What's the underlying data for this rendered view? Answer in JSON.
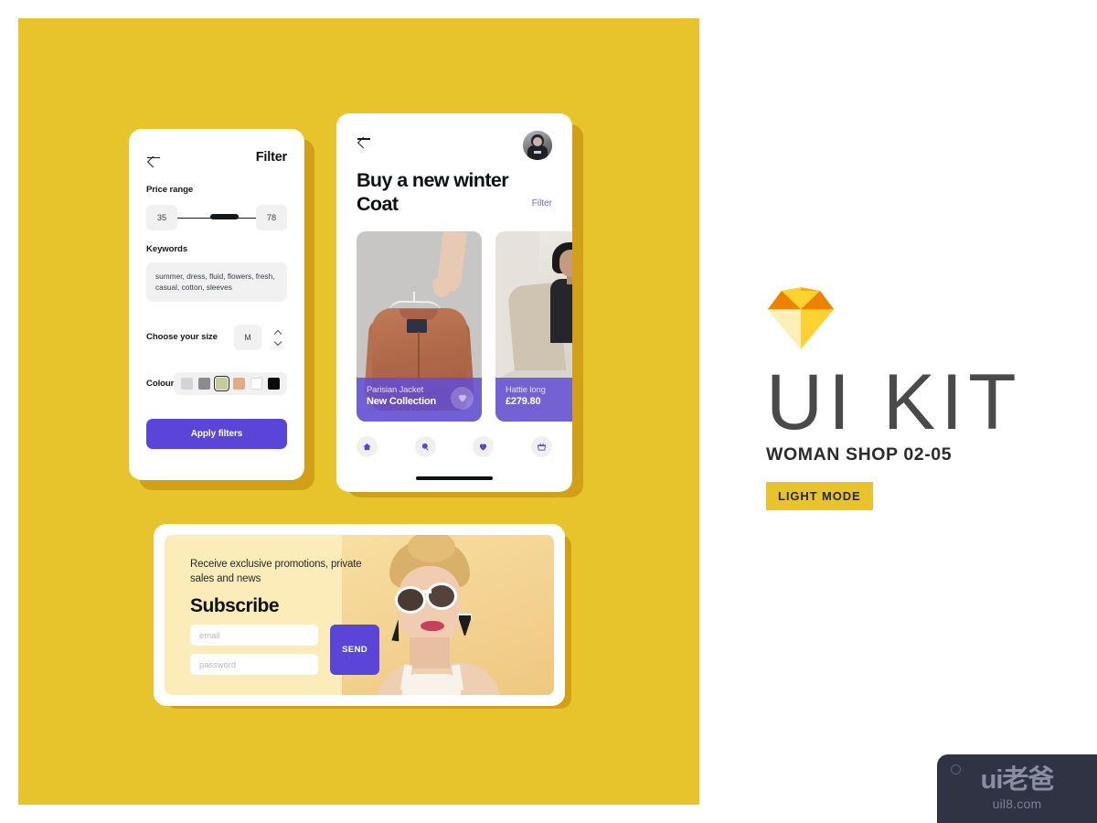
{
  "theme": {
    "backdrop_yellow": "#e8c42c",
    "card_shadow_gold": "#d2a017",
    "accent_purple": "#5a45d8",
    "link_purple": "#6e63d2",
    "text_dark": "#0f1013"
  },
  "filter_screen": {
    "back_icon": "back-arrow-icon",
    "title": "Filter",
    "price": {
      "label": "Price range",
      "min_value": "35",
      "max_value": "78"
    },
    "keywords": {
      "label": "Keywords",
      "value": "summer, dress, fluid, flowers, fresh, casual, cotton, sleeves"
    },
    "size": {
      "label": "Choose your size",
      "value": "M",
      "increase_icon": "chevron-up-icon",
      "decrease_icon": "chevron-down-icon"
    },
    "colour": {
      "label": "Colour",
      "swatches": [
        {
          "name": "light-grey",
          "hex": "#d4d4d6",
          "selected": false
        },
        {
          "name": "grey",
          "hex": "#8b8b8d",
          "selected": false
        },
        {
          "name": "khaki",
          "hex": "#c7cb9c",
          "selected": true
        },
        {
          "name": "salmon",
          "hex": "#e3ab8a",
          "selected": false
        },
        {
          "name": "white",
          "hex": "#ffffff",
          "selected": false
        },
        {
          "name": "black",
          "hex": "#0b0b0d",
          "selected": false
        }
      ]
    },
    "apply_label": "Apply filters"
  },
  "shop_screen": {
    "back_icon": "back-arrow-icon",
    "avatar": "user-avatar",
    "title": "Buy a new winter Coat",
    "filter_link": "Filter",
    "products": [
      {
        "name": "Parisian Jacket",
        "subtitle": "New Collection",
        "image": "brown-jacket-on-hanger",
        "favourite_icon": "heart-icon"
      },
      {
        "name": "Hattie long",
        "subtitle": "£279.80",
        "image": "woman-in-beige-coat"
      }
    ],
    "tabs": [
      {
        "name": "home-icon"
      },
      {
        "name": "search-icon"
      },
      {
        "name": "heart-icon"
      },
      {
        "name": "basket-icon"
      }
    ]
  },
  "subscribe_card": {
    "kicker": "Receive exclusive promotions, private sales and news",
    "title": "Subscribe",
    "email_placeholder": "email",
    "email_value": "",
    "password_placeholder": "password",
    "password_value": "",
    "send_label": "SEND",
    "photo": "woman-with-white-sunglasses"
  },
  "branding": {
    "logo": "sketch-diamond-logo",
    "ui_kit": "UI KIT",
    "subtitle": "WOMAN SHOP 02-05",
    "mode_badge": "LIGHT MODE"
  },
  "watermark": {
    "main": "ui老爸",
    "sub": "uil8.com",
    "dot_icon": "circle-icon"
  }
}
